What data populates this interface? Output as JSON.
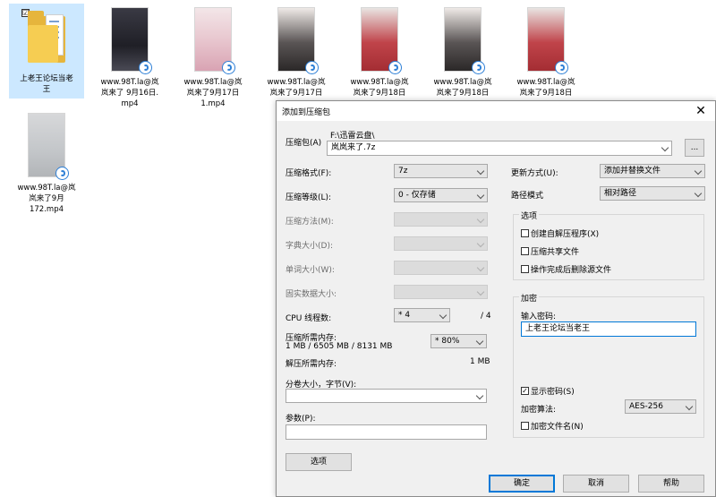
{
  "desktop": {
    "files": [
      {
        "name": "上老王论坛当老\n王",
        "type": "folder",
        "checked_mark": "☑"
      },
      {
        "name": "www.98T.la@岚\n岚来了 9月16日.\nmp4",
        "type": "video"
      },
      {
        "name": "www.98T.la@岚\n岚来了9月17日\n1.mp4",
        "type": "video"
      },
      {
        "name": "www.98T.la@岚\n岚来了9月17日",
        "type": "video"
      },
      {
        "name": "www.98T.la@岚\n岚来了9月18日",
        "type": "video"
      },
      {
        "name": "www.98T.la@岚\n岚来了9月18日",
        "type": "video"
      },
      {
        "name": "www.98T.la@岚\n岚来了9月18日",
        "type": "video"
      },
      {
        "name": "www.98T.la@岚\n岚来了9月\n172.mp4",
        "type": "video"
      }
    ]
  },
  "dialog": {
    "title": "添加到压缩包",
    "close_glyph": "✕",
    "archive_label": "压缩包(A)",
    "archive_path": "F:\\迅雷云盘\\",
    "archive_name": "岚岚来了.7z",
    "browse_label": "...",
    "format_label": "压缩格式(F):",
    "format_value": "7z",
    "level_label": "压缩等级(L):",
    "level_value": "0 - 仅存储",
    "method_label": "压缩方法(M):",
    "dict_label": "字典大小(D):",
    "word_label": "单词大小(W):",
    "solid_label": "固实数据大小:",
    "cpu_label": "CPU 线程数:",
    "cpu_value": "* 4",
    "cpu_max": "/ 4",
    "mem_label": "压缩所需内存:",
    "mem_detail": "1 MB / 6505 MB / 8131 MB",
    "mem_value": "* 80%",
    "decomp_label": "解压所需内存:",
    "decomp_value": "1 MB",
    "split_label": "分卷大小，字节(V):",
    "split_value": "",
    "params_label": "参数(P):",
    "params_value": "",
    "options_button": "选项",
    "update_label": "更新方式(U):",
    "update_value": "添加并替换文件",
    "path_label": "路径模式",
    "path_value": "相对路径",
    "options_group": "选项",
    "opt_sfx": "创建自解压程序(X)",
    "opt_shared": "压缩共享文件",
    "opt_delete": "操作完成后删除源文件",
    "encrypt_group": "加密",
    "password_label": "输入密码:",
    "password_value": "上老王论坛当老王",
    "show_password": "显示密码(S)",
    "show_password_mark": "✓",
    "enc_method_label": "加密算法:",
    "enc_method_value": "AES-256",
    "encrypt_names": "加密文件名(N)",
    "ok": "确定",
    "cancel": "取消",
    "help": "帮助"
  }
}
